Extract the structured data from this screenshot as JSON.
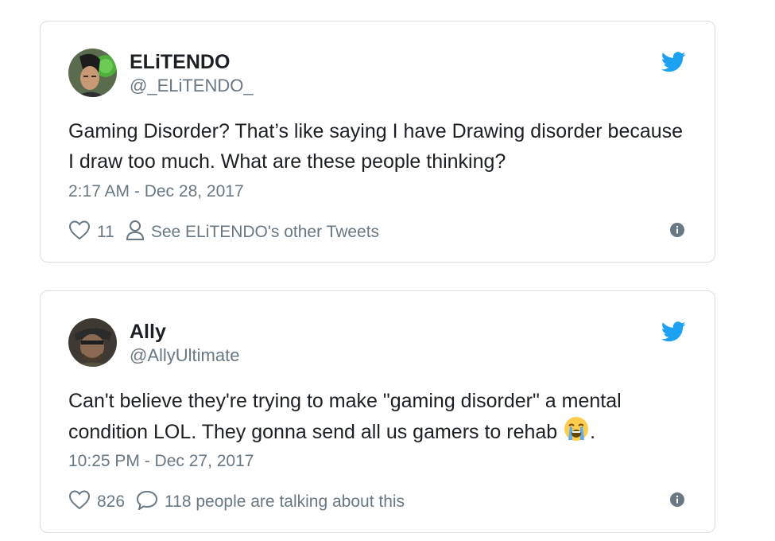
{
  "tweets": [
    {
      "name": "ELiTENDO",
      "handle": "@_ELiTENDO_",
      "text": "Gaming Disorder? That’s like saying I have Drawing disorder because I draw too much. What are these people thinking?",
      "text_suffix": "",
      "timestamp": "2:17 AM - Dec 28, 2017",
      "likes": "11",
      "secondary_action": "See ELiTENDO's other Tweets",
      "secondary_icon": "person-icon"
    },
    {
      "name": "Ally",
      "handle": "@AllyUltimate",
      "text": "Can't believe they're trying to make \"gaming disorder\" a mental condition LOL. They gonna send all us gamers to rehab ",
      "text_suffix": ".",
      "emoji": "loudly-crying-face-emoji",
      "timestamp": "10:25 PM - Dec 27, 2017",
      "likes": "826",
      "secondary_action": "118 people are talking about this",
      "secondary_icon": "comment-icon"
    }
  ],
  "colors": {
    "twitter_blue": "#1da1f2",
    "text": "#1c2024",
    "muted": "#697882",
    "border": "#d9dde1"
  }
}
